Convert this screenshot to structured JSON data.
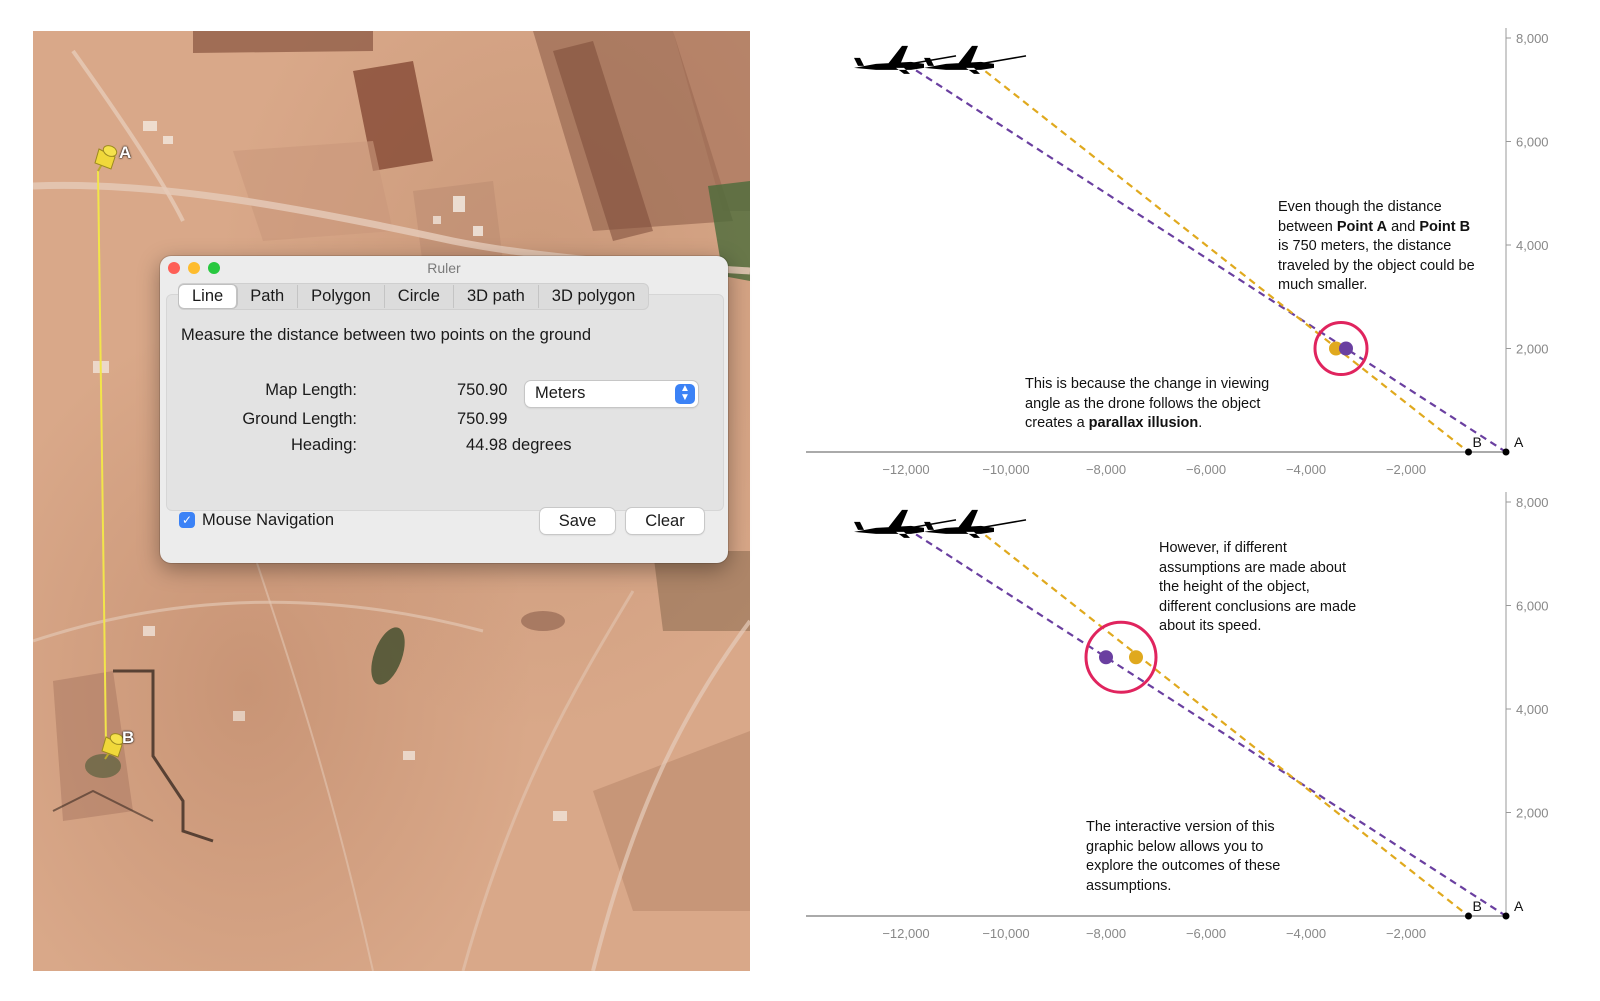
{
  "map": {
    "pin_a_label": "A",
    "pin_b_label": "B"
  },
  "ruler": {
    "title": "Ruler",
    "tabs": [
      "Line",
      "Path",
      "Polygon",
      "Circle",
      "3D path",
      "3D polygon"
    ],
    "active_tab": "Line",
    "description": "Measure the distance between two points on the ground",
    "map_length_label": "Map Length:",
    "map_length_value": "750.90",
    "unit": "Meters",
    "ground_length_label": "Ground Length:",
    "ground_length_value": "750.99",
    "heading_label": "Heading:",
    "heading_value": "44.98 degrees",
    "mouse_navigation_label": "Mouse Navigation",
    "mouse_navigation_checked": true,
    "save_label": "Save",
    "clear_label": "Clear"
  },
  "colors": {
    "purple": "#6a3fa0",
    "gold": "#e0a91e",
    "highlight": "#e0245e",
    "axis": "#999999"
  },
  "chart_data": [
    {
      "type": "scatter",
      "xlim": [
        -14000,
        0
      ],
      "ylim": [
        0,
        8000
      ],
      "x_ticks": [
        "−12,000",
        "−10,000",
        "−8,000",
        "−6,000",
        "−4,000",
        "−2,000"
      ],
      "x_tick_values": [
        -12000,
        -10000,
        -8000,
        -6000,
        -4000,
        -2000
      ],
      "y_ticks": [
        "8,000",
        "6,000",
        "4,000",
        "2,000"
      ],
      "y_tick_values": [
        8000,
        6000,
        4000,
        2000
      ],
      "drones": [
        {
          "x": -12000,
          "y": 7500
        },
        {
          "x": -10600,
          "y": 7500
        }
      ],
      "ground_points": [
        {
          "label": "B",
          "x": -750,
          "y": 0
        },
        {
          "label": "A",
          "x": 0,
          "y": 0
        }
      ],
      "sightlines": [
        {
          "color": "purple",
          "from": [
            -12000,
            7500
          ],
          "to": [
            0,
            0
          ]
        },
        {
          "color": "gold",
          "from": [
            -10600,
            7500
          ],
          "to": [
            -750,
            0
          ]
        }
      ],
      "objects": [
        {
          "color": "gold",
          "x": -3400,
          "y": 2000
        },
        {
          "color": "purple",
          "x": -3200,
          "y": 2000
        }
      ],
      "highlight_circle": {
        "x": -3300,
        "y": 2000
      },
      "annotation_1": {
        "t1": "Even though the distance",
        "t2_pre": "between ",
        "t2_bold1": "Point A",
        "t2_mid": " and ",
        "t2_bold2": "Point B",
        "t3": "is 750 meters, the distance",
        "t4": "traveled by the object could be",
        "t5": "much smaller."
      },
      "annotation_2": {
        "t1": "This is because the change in viewing",
        "t2": "angle as the drone follows the object",
        "t3_pre": "creates a ",
        "t3_bold": "parallax illusion",
        "t3_post": "."
      }
    },
    {
      "type": "scatter",
      "xlim": [
        -14000,
        0
      ],
      "ylim": [
        0,
        8000
      ],
      "x_ticks": [
        "−12,000",
        "−10,000",
        "−8,000",
        "−6,000",
        "−4,000",
        "−2,000"
      ],
      "x_tick_values": [
        -12000,
        -10000,
        -8000,
        -6000,
        -4000,
        -2000
      ],
      "y_ticks": [
        "8,000",
        "6,000",
        "4,000",
        "2,000"
      ],
      "y_tick_values": [
        8000,
        6000,
        4000,
        2000
      ],
      "drones": [
        {
          "x": -12000,
          "y": 7500
        },
        {
          "x": -10600,
          "y": 7500
        }
      ],
      "ground_points": [
        {
          "label": "B",
          "x": -750,
          "y": 0
        },
        {
          "label": "A",
          "x": 0,
          "y": 0
        }
      ],
      "sightlines": [
        {
          "color": "purple",
          "from": [
            -12000,
            7500
          ],
          "to": [
            0,
            0
          ]
        },
        {
          "color": "gold",
          "from": [
            -10600,
            7500
          ],
          "to": [
            -750,
            0
          ]
        }
      ],
      "objects": [
        {
          "color": "purple",
          "x": -8000,
          "y": 5000
        },
        {
          "color": "gold",
          "x": -7400,
          "y": 5000
        }
      ],
      "highlight_circle": {
        "x": -7700,
        "y": 5000
      },
      "annotation_1": {
        "t1": "However, if different",
        "t2": "assumptions are made about",
        "t3": "the height of the object,",
        "t4": "different conclusions are made",
        "t5": "about its speed."
      },
      "annotation_2": {
        "t1": "The interactive version of this",
        "t2": "graphic below allows you to",
        "t3": "explore the outcomes of these",
        "t4": "assumptions."
      }
    }
  ]
}
